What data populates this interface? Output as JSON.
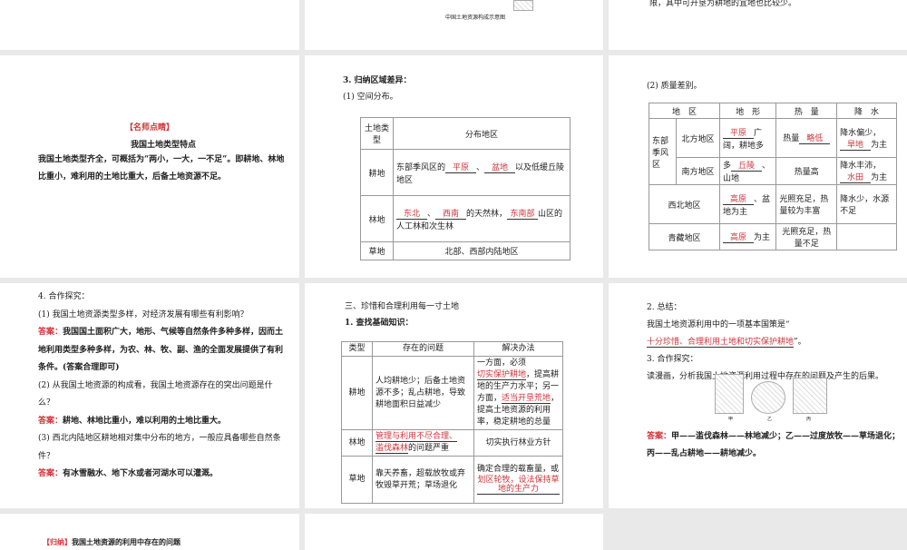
{
  "top": {
    "caption": "中国土地资源构成示意图",
    "right_text": "限，其中可开垦为耕地的宜地也比较少。"
  },
  "tip": {
    "tag": "【名师点睛】",
    "title": "我国土地类型特点",
    "text": "我国土地类型齐全，可概括为“两小，一大，一不足”。即耕地、林地比重小，难利用的土地比重大，后备土地资源不足。"
  },
  "dist": {
    "h1": "3. 归纳区域差异：",
    "h2": "(1) 空间分布。",
    "col1": "土地类型",
    "col2": "分布地区",
    "rows": [
      {
        "type": "耕地",
        "pre": "东部季风区的",
        "a1": "平原",
        "sep": "、",
        "a2": "盆地",
        "post": "以及低缓丘陵地区"
      },
      {
        "type": "林地",
        "a1": "东北",
        "sep": "、",
        "a2": "西南",
        "mid": "的天然林，",
        "a3": "东南部",
        "post": "山区的人工林和次生林"
      },
      {
        "type": "草地",
        "text": "北部、西部内陆地区"
      }
    ]
  },
  "quality": {
    "h": "(2) 质量差别。",
    "headers": [
      "地　区",
      "地　形",
      "热　量",
      "降　水"
    ],
    "monsoon": "东部季风区",
    "north": {
      "region": "北方地区",
      "t_ans": "平原",
      "t_post": "广阔，耕地多",
      "h_pre": "热量",
      "h_ans": "略低",
      "p_pre": "降水偏少，",
      "p_ans": "旱地",
      "p_post": "为主"
    },
    "south": {
      "region": "南方地区",
      "t_pre": "多",
      "t_ans": "丘陵",
      "t_post": "、山地",
      "heat": "热量高",
      "p_pre": "降水丰沛，",
      "p_ans": "水田",
      "p_post": "为主"
    },
    "nw": {
      "region": "西北地区",
      "t_ans": "高原",
      "t_post": "、盆地为主",
      "heat": "光照充足，热量较为丰富",
      "prec": "降水少，水源不足"
    },
    "qt": {
      "region": "青藏地区",
      "t_ans": "高原",
      "t_post": "为主",
      "heat": "光照充足，热量不足"
    }
  },
  "coop": {
    "h": "4. 合作探究：",
    "label": "答案：",
    "q1": "(1) 我国土地资源类型多样，对经济发展有哪些有利影响？",
    "a1": "我国国土面积广大，地形、气候等自然条件多种多样，因而土地利用类型多种多样，为农、林、牧、副、渔的全面发展提供了有利条件。(答案合理即可)",
    "q2": "(2) 从我国土地资源的构成看，我国土地资源存在的突出问题是什么？",
    "a2": "耕地、林地比重小，难以利用的土地比重大。",
    "q3": "(3) 西北内陆地区耕地相对集中分布的地方，一般应具备哪些自然条件？",
    "a3": "有冰雪融水、地下水或者河湖水可以灌溉。"
  },
  "use": {
    "h1": "三、珍惜和合理利用每一寸土地",
    "h2": "1. 查找基础知识：",
    "headers": [
      "类型",
      "存在的问题",
      "解决办法"
    ],
    "r1": {
      "type": "耕地",
      "problem": "人均耕地少；后备土地资源不多；乱占耕地，导致耕地面积日益减少",
      "s1": "一方面，必须",
      "a1": "切实保护耕地",
      "s2": "，提高耕地的生产力水平；另一方面，",
      "a2": "适当开垦荒地",
      "s3": "，提高土地资源的利用率，稳定耕地的总量"
    },
    "r2": {
      "type": "林地",
      "a1": "管理与利用不尽合理、",
      "a2": "滥伐森林",
      "post": "的问题严重",
      "sol": "切实执行林业方针"
    },
    "r3": {
      "type": "草地",
      "problem": "靠天养畜，超载放牧或弃牧毁草开荒；草场退化",
      "s1": "确定合理的载畜量，或",
      "a1": "划区轮牧，设法保持草地的生产力"
    }
  },
  "summary": {
    "h": "2. 总结：",
    "pre": "我国土地资源利用中的一项基本国策是“",
    "ans": "十分珍惜、合理利用土地和切实保护耕地",
    "post": "”。",
    "h2": "3. 合作探究：",
    "q": "读漫画，分析我国土地资源利用过程中存在的问题及产生的后果。",
    "fig_labels": [
      "甲",
      "乙",
      "丙"
    ],
    "label": "答案：",
    "a": "甲——滥伐森林——林地减少；乙——过度放牧——草场退化；丙——乱占耕地——耕地减少。"
  },
  "bottom": {
    "tag": "【归纳】",
    "text": "我国土地资源的利用中存在的问题"
  }
}
